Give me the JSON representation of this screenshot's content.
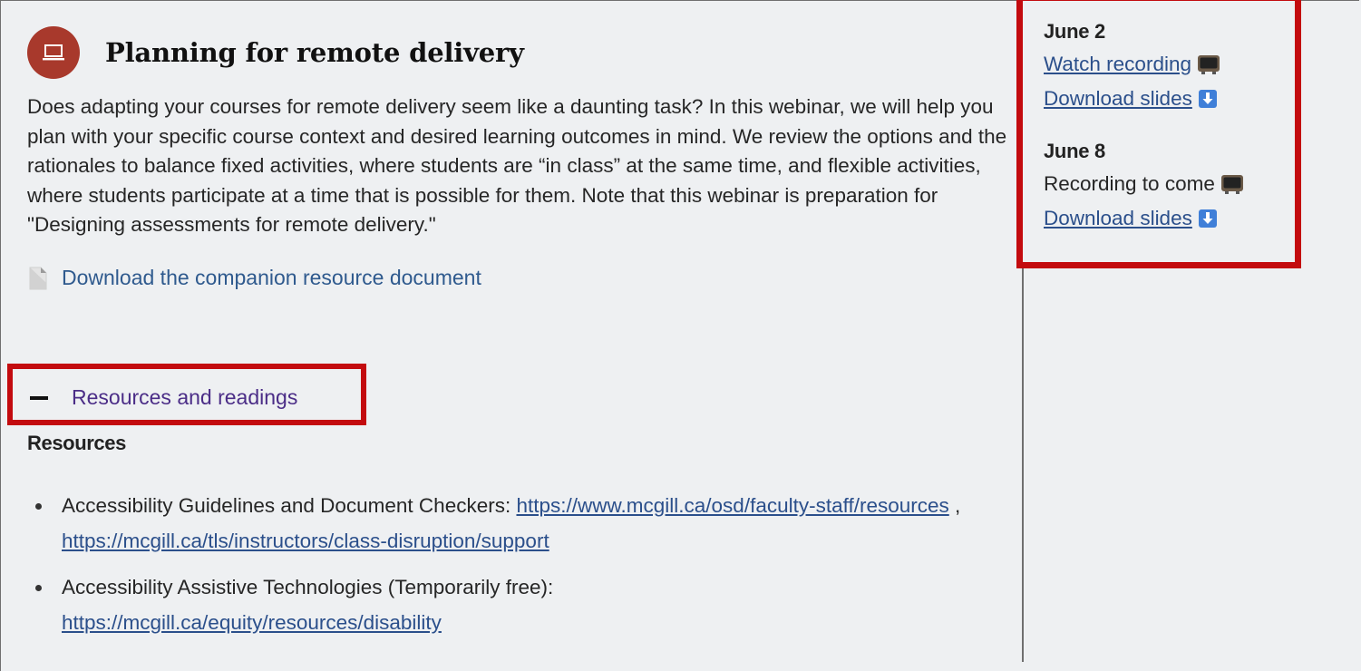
{
  "course": {
    "title": "Planning for remote delivery",
    "icon": "laptop-icon",
    "accent_color": "#a8392c",
    "description": "Does adapting your courses for remote delivery seem like a daunting task? In this webinar, we will help you plan with your specific course context and desired learning outcomes in mind. We review the options and the rationales to balance fixed activities, where students are “in class” at the same time, and flexible activities, where students participate at a time that is possible for them. Note that this webinar is preparation for \"Designing assessments for remote delivery.\""
  },
  "companion_link": {
    "label": "Download the companion resource document",
    "icon": "document-icon"
  },
  "resources_toggle": {
    "label": "Resources and readings",
    "icon": "minus-icon"
  },
  "resources": {
    "heading": "Resources",
    "items": [
      {
        "prefix": "Accessibility Guidelines and Document Checkers: ",
        "link1": "https://www.mcgill.ca/osd/faculty-staff/resources",
        "separator": " , ",
        "link2": "https://mcgill.ca/tls/instructors/class-disruption/support"
      },
      {
        "prefix": "Accessibility Assistive Technologies (Temporarily free):",
        "link1": "https://mcgill.ca/equity/resources/disability"
      }
    ]
  },
  "sessions": [
    {
      "date": "June 2",
      "recording_label": "Watch recording",
      "slides_label": "Download slides"
    },
    {
      "date": "June 8",
      "recording_label": "Recording to come",
      "slides_label": "Download slides"
    }
  ],
  "highlight_color": "#c30b0f"
}
